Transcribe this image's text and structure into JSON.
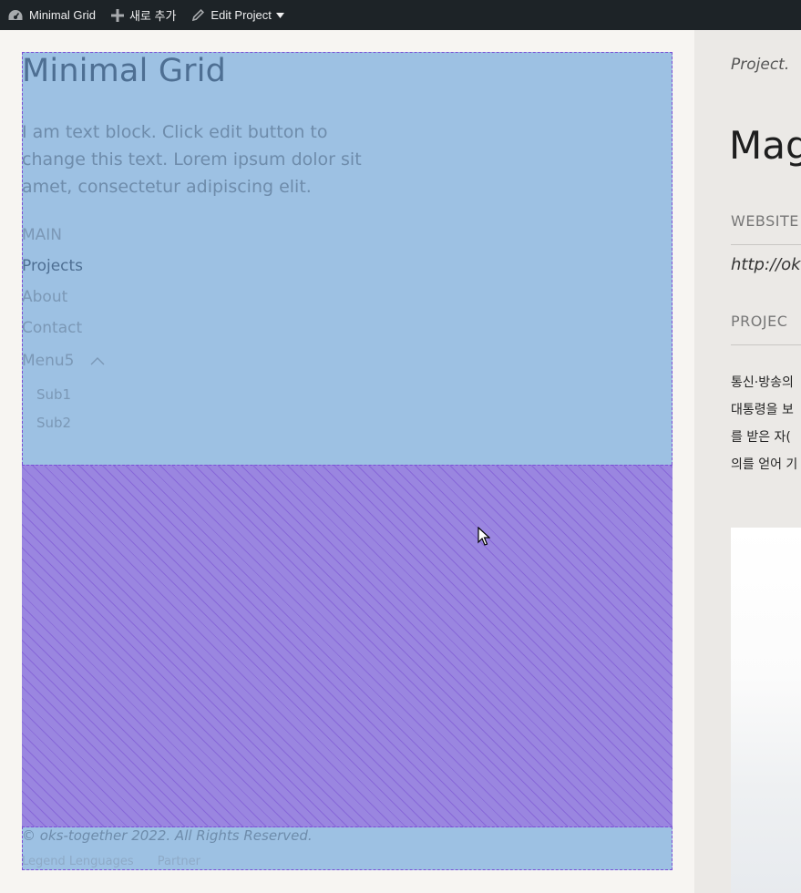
{
  "admin_bar": {
    "site_name": "Minimal Grid",
    "new_label": "새로 추가",
    "edit_label": "Edit Project"
  },
  "sidebar": {
    "site_title": "Minimal Grid",
    "intro": "I am text block. Click edit button to change this text. Lorem ipsum dolor sit amet, consectetur adipiscing elit.",
    "menu": [
      {
        "label": "MAIN",
        "active": false
      },
      {
        "label": "Projects",
        "active": true
      },
      {
        "label": "About",
        "active": false
      },
      {
        "label": "Contact",
        "active": false
      },
      {
        "label": "Menu5",
        "active": false
      }
    ],
    "submenu": [
      "Sub1",
      "Sub2"
    ],
    "copyright": "© oks-together 2022. All Rights Reserved.",
    "footer_links": [
      "Legend Lenguages",
      "Partner"
    ]
  },
  "content": {
    "category": "Project.",
    "title": "Mag",
    "website_label": "WEBSITE",
    "website_url": "http://ok",
    "project_label": "PROJEC",
    "body_lines": [
      "통신·방송의",
      "대통령을 보",
      "를 받은 자(",
      "의를 얻어 기"
    ]
  },
  "colors": {
    "admin_bar_bg": "#1d2327",
    "overlay_blue": "#9dc1e3",
    "overlay_purple": "#9a86e0",
    "content_bg": "#ebe9e6"
  }
}
